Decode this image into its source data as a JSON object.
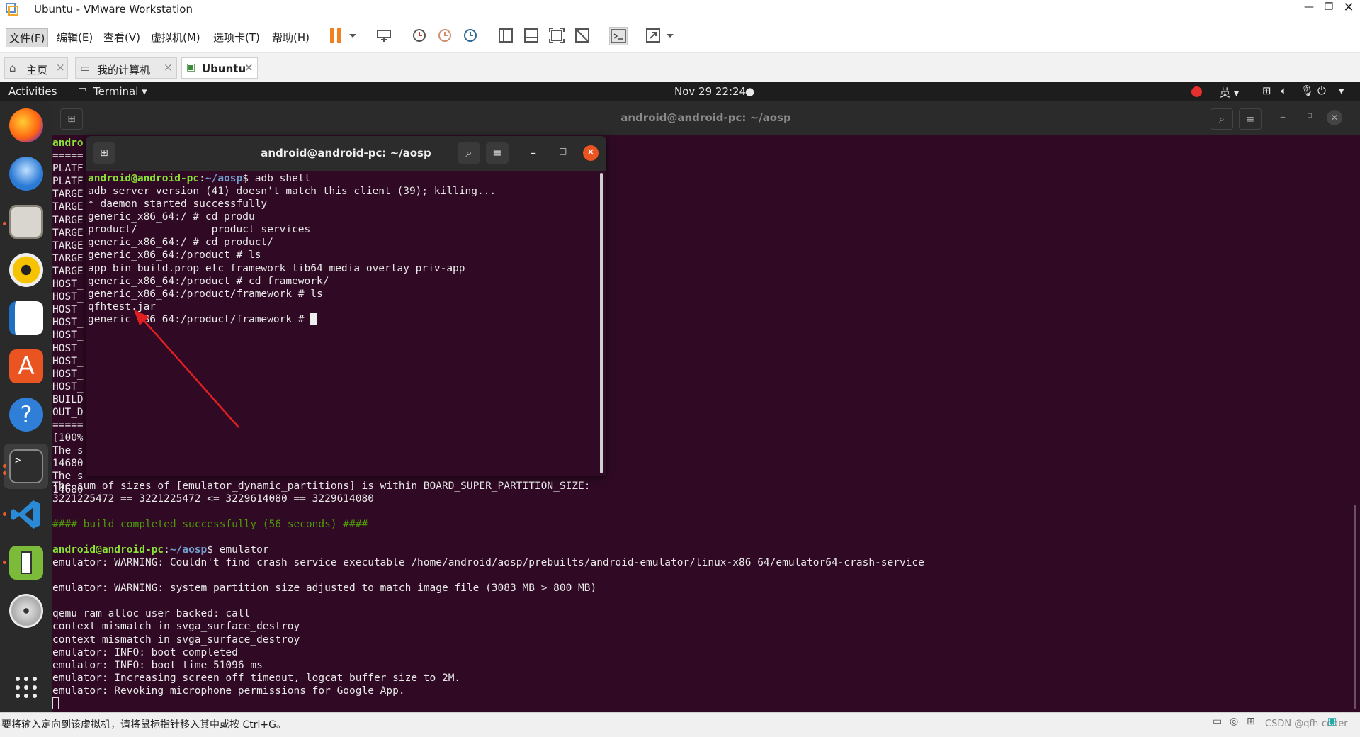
{
  "window": {
    "title": "Ubuntu - VMware Workstation"
  },
  "menus": [
    "文件(F)",
    "编辑(E)",
    "查看(V)",
    "虚拟机(M)",
    "选项卡(T)",
    "帮助(H)"
  ],
  "tabs": [
    {
      "label": "主页"
    },
    {
      "label": "我的计算机"
    },
    {
      "label": "Ubuntu"
    }
  ],
  "ubuntu_topbar": {
    "activities": "Activities",
    "app_menu": "Terminal ▾",
    "clock": "Nov 29  22:24",
    "input_method": "英 ▾"
  },
  "bg_terminal": {
    "title": "android@android-pc: ~/aosp",
    "left_lines": [
      "andro",
      "=====",
      "PLATF",
      "PLATF",
      "TARGE",
      "TARGE",
      "TARGE",
      "TARGE",
      "TARGE",
      "TARGE",
      "TARGE",
      "HOST_",
      "HOST_",
      "HOST_",
      "HOST_",
      "HOST_",
      "HOST_",
      "HOST_",
      "HOST_",
      "HOST_",
      "BUILD",
      "OUT_D",
      "=====",
      "[100%",
      "The s",
      "14680",
      "The s",
      "14680"
    ],
    "line_size_check": "The sum of sizes of [emulator_dynamic_partitions] is within BOARD_SUPER_PARTITION_SIZE:",
    "line_size_values": "3221225472 == 3221225472 <= 3229614080 == 3229614080",
    "build_done": "#### build completed successfully (56 seconds) ####",
    "prompt_user": "android@android-pc",
    "prompt_path": "~/aosp",
    "prompt_cmd": "$ emulator",
    "output": [
      "emulator: WARNING: Couldn't find crash service executable /home/android/aosp/prebuilts/android-emulator/linux-x86_64/emulator64-crash-service",
      "",
      "emulator: WARNING: system partition size adjusted to match image file (3083 MB > 800 MB)",
      "",
      "qemu_ram_alloc_user_backed: call",
      "context mismatch in svga_surface_destroy",
      "context mismatch in svga_surface_destroy",
      "emulator: INFO: boot completed",
      "emulator: INFO: boot time 51096 ms",
      "emulator: Increasing screen off timeout, logcat buffer size to 2M.",
      "emulator: Revoking microphone permissions for Google App."
    ]
  },
  "fg_terminal": {
    "title": "android@android-pc: ~/aosp",
    "prompt_user": "android@android-pc",
    "prompt_path": "~/aosp",
    "prompt_cmd": "$ adb shell",
    "lines": [
      "adb server version (41) doesn't match this client (39); killing...",
      "* daemon started successfully",
      "generic_x86_64:/ # cd produ",
      "product/            product_services",
      "generic_x86_64:/ # cd product/",
      "generic_x86_64:/product # ls",
      "app bin build.prop etc framework lib64 media overlay priv-app",
      "generic_x86_64:/product # cd framework/",
      "generic_x86_64:/product/framework # ls",
      "qfhtest.jar",
      "generic_x86_64:/product/framework # "
    ]
  },
  "statusbar": {
    "hint": "要将输入定向到该虚拟机，请将鼠标指针移入其中或按 Ctrl+G。",
    "watermark": "CSDN @qfh-coder"
  },
  "colors": {
    "terminal_bg": "#300a24",
    "prompt_user": "#8ae234",
    "prompt_path": "#729fcf",
    "annotation_arrow": "#e02020"
  }
}
